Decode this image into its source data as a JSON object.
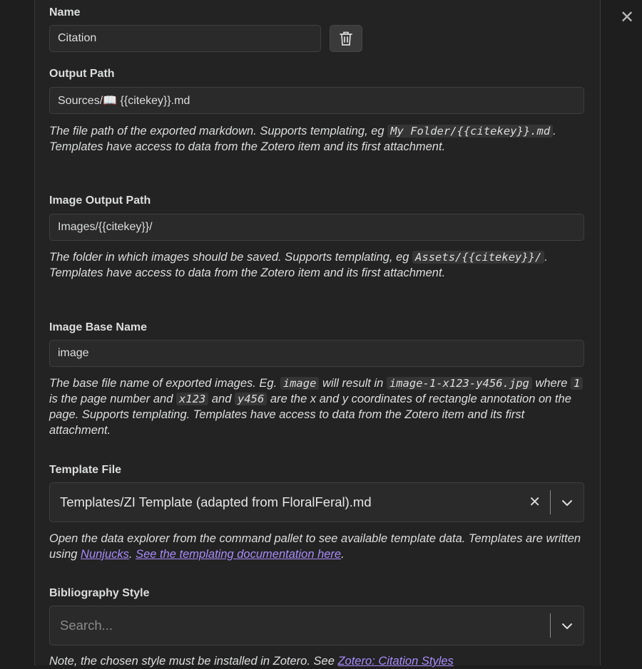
{
  "dialog": {
    "close_label": "✕"
  },
  "name": {
    "label": "Name",
    "value": "Citation"
  },
  "output_path": {
    "label": "Output Path",
    "value": "Sources/📖 {{citekey}}.md",
    "desc_1": "The file path of the exported markdown. Supports templating, eg ",
    "code": "My Folder/{{citekey}}.md",
    "desc_2": ". Templates have access to data from the Zotero item and its first attachment."
  },
  "image_output_path": {
    "label": "Image Output Path",
    "value": "Images/{{citekey}}/",
    "desc_1": "The folder in which images should be saved. Supports templating, eg ",
    "code": "Assets/{{citekey}}/",
    "desc_2": ". Templates have access to data from the Zotero item and its first attachment."
  },
  "image_base_name": {
    "label": "Image Base Name",
    "value": "image",
    "desc_1": "The base file name of exported images. Eg. ",
    "code_1": "image",
    "desc_2": " will result in ",
    "code_2": "image-1-x123-y456.jpg",
    "desc_3": " where ",
    "code_3": "1",
    "desc_4": " is the page number and ",
    "code_4": "x123",
    "desc_5": " and ",
    "code_5": "y456",
    "desc_6": " are the x and y coordinates of rectangle annotation on the page. Supports templating. Templates have access to data from the Zotero item and its first attachment."
  },
  "template_file": {
    "label": "Template File",
    "value": "Templates/ZI Template (adapted from FloralFeral).md",
    "clear_label": "✕",
    "desc_1": "Open the data explorer from the command pallet to see available template data. Templates are written using ",
    "link_1": "Nunjucks",
    "desc_2": ". ",
    "link_2": "See the templating documentation here",
    "desc_3": "."
  },
  "bibliography_style": {
    "label": "Bibliography Style",
    "placeholder": "Search...",
    "note": "Note, the chosen style must be installed in Zotero. See ",
    "note_link": "Zotero: Citation Styles"
  },
  "colors": {
    "accent_link": "#a88bfa",
    "background": "#1e1e1e",
    "input_bg": "#2a2a2a"
  },
  "icons": {
    "trash": "trash-icon",
    "close": "close-icon",
    "chevron": "chevron-down-icon"
  }
}
